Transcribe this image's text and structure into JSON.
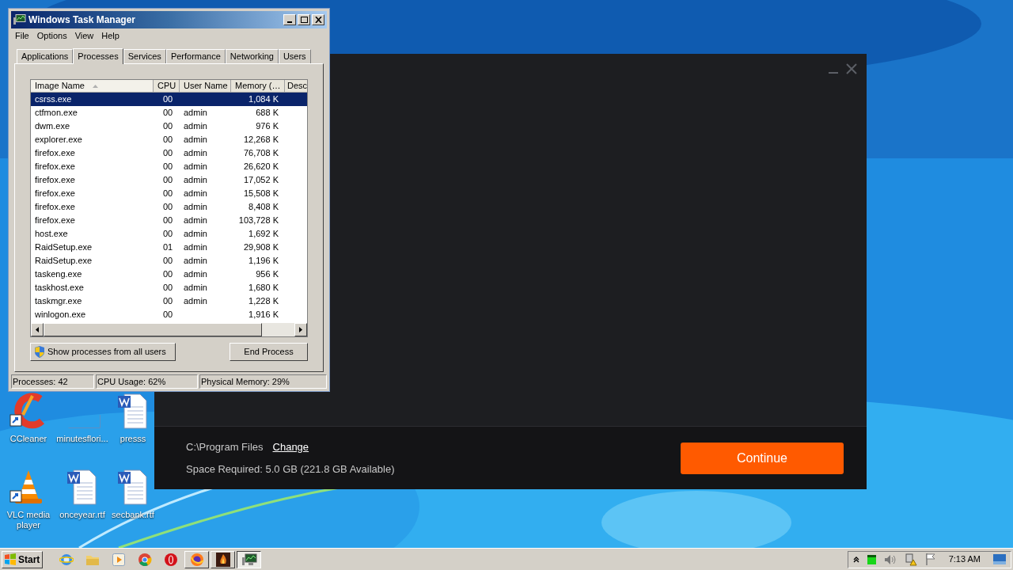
{
  "task_manager": {
    "title": "Windows Task Manager",
    "menu": [
      "File",
      "Options",
      "View",
      "Help"
    ],
    "tabs": [
      {
        "label": "Applications",
        "selected": false
      },
      {
        "label": "Processes",
        "selected": true
      },
      {
        "label": "Services",
        "selected": false
      },
      {
        "label": "Performance",
        "selected": false
      },
      {
        "label": "Networking",
        "selected": false
      },
      {
        "label": "Users",
        "selected": false
      }
    ],
    "columns": [
      {
        "label": "Image Name",
        "sorted": true
      },
      {
        "label": "CPU",
        "sorted": false
      },
      {
        "label": "User Name",
        "sorted": false
      },
      {
        "label": "Memory (…",
        "sorted": false
      },
      {
        "label": "Desc",
        "sorted": false
      }
    ],
    "rows": [
      {
        "cells": [
          "csrss.exe",
          "00",
          "",
          "1,084 K"
        ],
        "selected": true
      },
      {
        "cells": [
          "ctfmon.exe",
          "00",
          "admin",
          "688 K"
        ],
        "selected": false
      },
      {
        "cells": [
          "dwm.exe",
          "00",
          "admin",
          "976 K"
        ],
        "selected": false
      },
      {
        "cells": [
          "explorer.exe",
          "00",
          "admin",
          "12,268 K"
        ],
        "selected": false
      },
      {
        "cells": [
          "firefox.exe",
          "00",
          "admin",
          "76,708 K"
        ],
        "selected": false
      },
      {
        "cells": [
          "firefox.exe",
          "00",
          "admin",
          "26,620 K"
        ],
        "selected": false
      },
      {
        "cells": [
          "firefox.exe",
          "00",
          "admin",
          "17,052 K"
        ],
        "selected": false
      },
      {
        "cells": [
          "firefox.exe",
          "00",
          "admin",
          "15,508 K"
        ],
        "selected": false
      },
      {
        "cells": [
          "firefox.exe",
          "00",
          "admin",
          "8,408 K"
        ],
        "selected": false
      },
      {
        "cells": [
          "firefox.exe",
          "00",
          "admin",
          "103,728 K"
        ],
        "selected": false
      },
      {
        "cells": [
          "host.exe",
          "00",
          "admin",
          "1,692 K"
        ],
        "selected": false
      },
      {
        "cells": [
          "RaidSetup.exe",
          "01",
          "admin",
          "29,908 K"
        ],
        "selected": false
      },
      {
        "cells": [
          "RaidSetup.exe",
          "00",
          "admin",
          "1,196 K"
        ],
        "selected": false
      },
      {
        "cells": [
          "taskeng.exe",
          "00",
          "admin",
          "956 K"
        ],
        "selected": false
      },
      {
        "cells": [
          "taskhost.exe",
          "00",
          "admin",
          "1,680 K"
        ],
        "selected": false
      },
      {
        "cells": [
          "taskmgr.exe",
          "00",
          "admin",
          "1,228 K"
        ],
        "selected": false
      },
      {
        "cells": [
          "winlogon.exe",
          "00",
          "",
          "1,916 K"
        ],
        "selected": false
      }
    ],
    "show_all_button": "Show processes from all users",
    "end_button": "End Process",
    "status_bar": [
      "Processes: 42",
      "CPU Usage: 62%",
      "Physical Memory: 29%"
    ]
  },
  "desktop_icons": [
    {
      "kind": "ccleaner",
      "label": "CCleaner"
    },
    {
      "kind": "blank",
      "label": "minutesflori..."
    },
    {
      "kind": "word",
      "label": "presss"
    },
    {
      "kind": "vlc",
      "label": "VLC media player"
    },
    {
      "kind": "word",
      "label": "onceyear.rtf"
    },
    {
      "kind": "word",
      "label": "secbank.rtf"
    }
  ],
  "installer": {
    "path": "C:\\Program Files",
    "change_link": "Change",
    "space": "Space Required: 5.0 GB (221.8 GB Available)",
    "continue_button": "Continue"
  },
  "taskbar": {
    "start": "Start",
    "apps": [
      {
        "kind": "ie",
        "running": false,
        "selected": false
      },
      {
        "kind": "folder",
        "running": false,
        "selected": false
      },
      {
        "kind": "media",
        "running": false,
        "selected": false
      },
      {
        "kind": "chrome",
        "running": false,
        "selected": false
      },
      {
        "kind": "opera",
        "running": false,
        "selected": false
      },
      {
        "kind": "firefox",
        "running": true,
        "selected": false
      },
      {
        "kind": "game",
        "running": true,
        "selected": false
      },
      {
        "kind": "taskmgr",
        "running": true,
        "selected": true
      }
    ],
    "clock": "7:13 AM"
  }
}
